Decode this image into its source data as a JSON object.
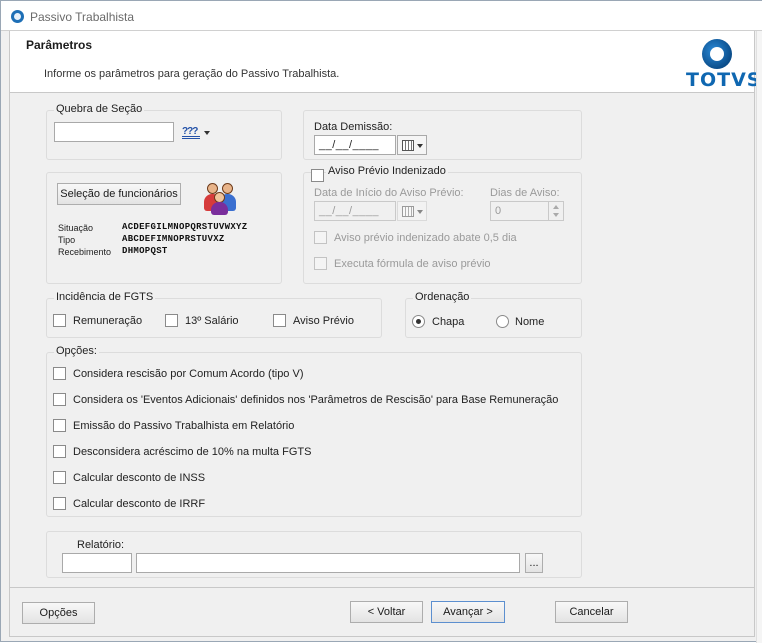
{
  "window": {
    "title": "Passivo Trabalhista"
  },
  "header": {
    "title": "Parâmetros",
    "subtitle": "Informe os parâmetros para geração do Passivo Trabalhista.",
    "logo_text": "TOTVS",
    "brand_color": "#0f67b1"
  },
  "quebra_secao": {
    "title": "Quebra de Seção",
    "value": ""
  },
  "selecao": {
    "button_label": "Seleção de funcionários",
    "rows": [
      {
        "label": "Situação",
        "value": "ACDEFGILMNOPQRSTUVWXYZ"
      },
      {
        "label": "Tipo",
        "value": "ABCDEFIMNOPRSTUVXZ"
      },
      {
        "label": "Recebimento",
        "value": "DHMOPQST"
      }
    ]
  },
  "demissao": {
    "label": "Data Demissão:",
    "value": "__/__/____"
  },
  "aviso": {
    "checkbox_label": "Aviso Prévio Indenizado",
    "checked": false,
    "inicio_label": "Data de Início do Aviso Prévio:",
    "inicio_value": "__/__/____",
    "dias_label": "Dias de Aviso:",
    "dias_value": "0",
    "abate_label": "Aviso prévio indenizado abate 0,5 dia",
    "formula_label": "Executa fórmula de aviso prévio"
  },
  "fgts": {
    "title": "Incidência de FGTS",
    "options": [
      {
        "label": "Remuneração",
        "checked": false
      },
      {
        "label": "13º Salário",
        "checked": false
      },
      {
        "label": "Aviso Prévio",
        "checked": false
      }
    ]
  },
  "ordenacao": {
    "title": "Ordenação",
    "options": [
      {
        "label": "Chapa",
        "selected": true
      },
      {
        "label": "Nome",
        "selected": false
      }
    ]
  },
  "opcoes": {
    "title": "Opções:",
    "items": [
      {
        "label": "Considera rescisão por Comum Acordo (tipo V)",
        "checked": false
      },
      {
        "label": "Considera os 'Eventos Adicionais' definidos nos 'Parâmetros de Rescisão' para Base Remuneração",
        "checked": false
      },
      {
        "label": "Emissão do Passivo Trabalhista em Relatório",
        "checked": false
      },
      {
        "label": "Desconsidera acréscimo de 10% na multa FGTS",
        "checked": false
      },
      {
        "label": "Calcular desconto de INSS",
        "checked": false
      },
      {
        "label": "Calcular desconto de IRRF",
        "checked": false
      }
    ]
  },
  "relatorio": {
    "label": "Relatório:",
    "code": "",
    "name": "",
    "browse_label": "..."
  },
  "footer": {
    "options_label": "Opções",
    "back_label": "< Voltar",
    "next_label": "Avançar >",
    "cancel_label": "Cancelar"
  }
}
